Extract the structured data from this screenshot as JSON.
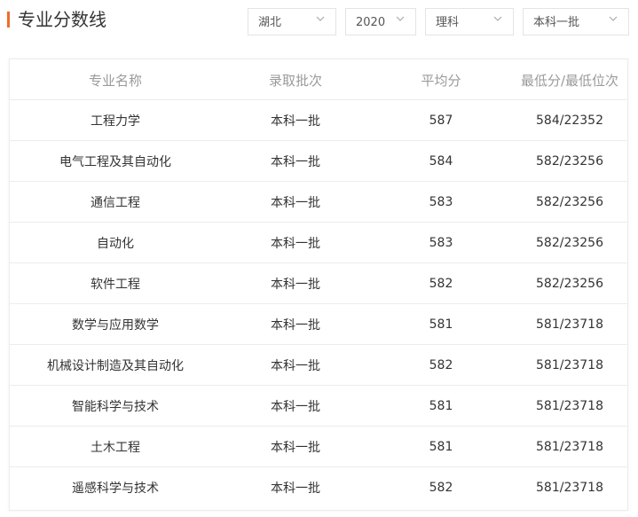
{
  "header": {
    "title": "专业分数线"
  },
  "filters": {
    "province": "湖北",
    "year": "2020",
    "subject": "理科",
    "batch": "本科一批"
  },
  "table": {
    "columns": [
      "专业名称",
      "录取批次",
      "平均分",
      "最低分/最低位次"
    ],
    "rows": [
      {
        "major": "工程力学",
        "batch": "本科一批",
        "avg": "587",
        "min": "584/22352"
      },
      {
        "major": "电气工程及其自动化",
        "batch": "本科一批",
        "avg": "584",
        "min": "582/23256"
      },
      {
        "major": "通信工程",
        "batch": "本科一批",
        "avg": "583",
        "min": "582/23256"
      },
      {
        "major": "自动化",
        "batch": "本科一批",
        "avg": "583",
        "min": "582/23256"
      },
      {
        "major": "软件工程",
        "batch": "本科一批",
        "avg": "582",
        "min": "582/23256"
      },
      {
        "major": "数学与应用数学",
        "batch": "本科一批",
        "avg": "581",
        "min": "581/23718"
      },
      {
        "major": "机械设计制造及其自动化",
        "batch": "本科一批",
        "avg": "582",
        "min": "581/23718"
      },
      {
        "major": "智能科学与技术",
        "batch": "本科一批",
        "avg": "581",
        "min": "581/23718"
      },
      {
        "major": "土木工程",
        "batch": "本科一批",
        "avg": "581",
        "min": "581/23718"
      },
      {
        "major": "遥感科学与技术",
        "batch": "本科一批",
        "avg": "582",
        "min": "581/23718"
      }
    ]
  },
  "colors": {
    "accent": "#f16c27",
    "border": "#ececec",
    "header_text": "#9a9a9a",
    "body_text": "#333333"
  },
  "icons": {
    "dropdown": "chevron-down-icon"
  }
}
